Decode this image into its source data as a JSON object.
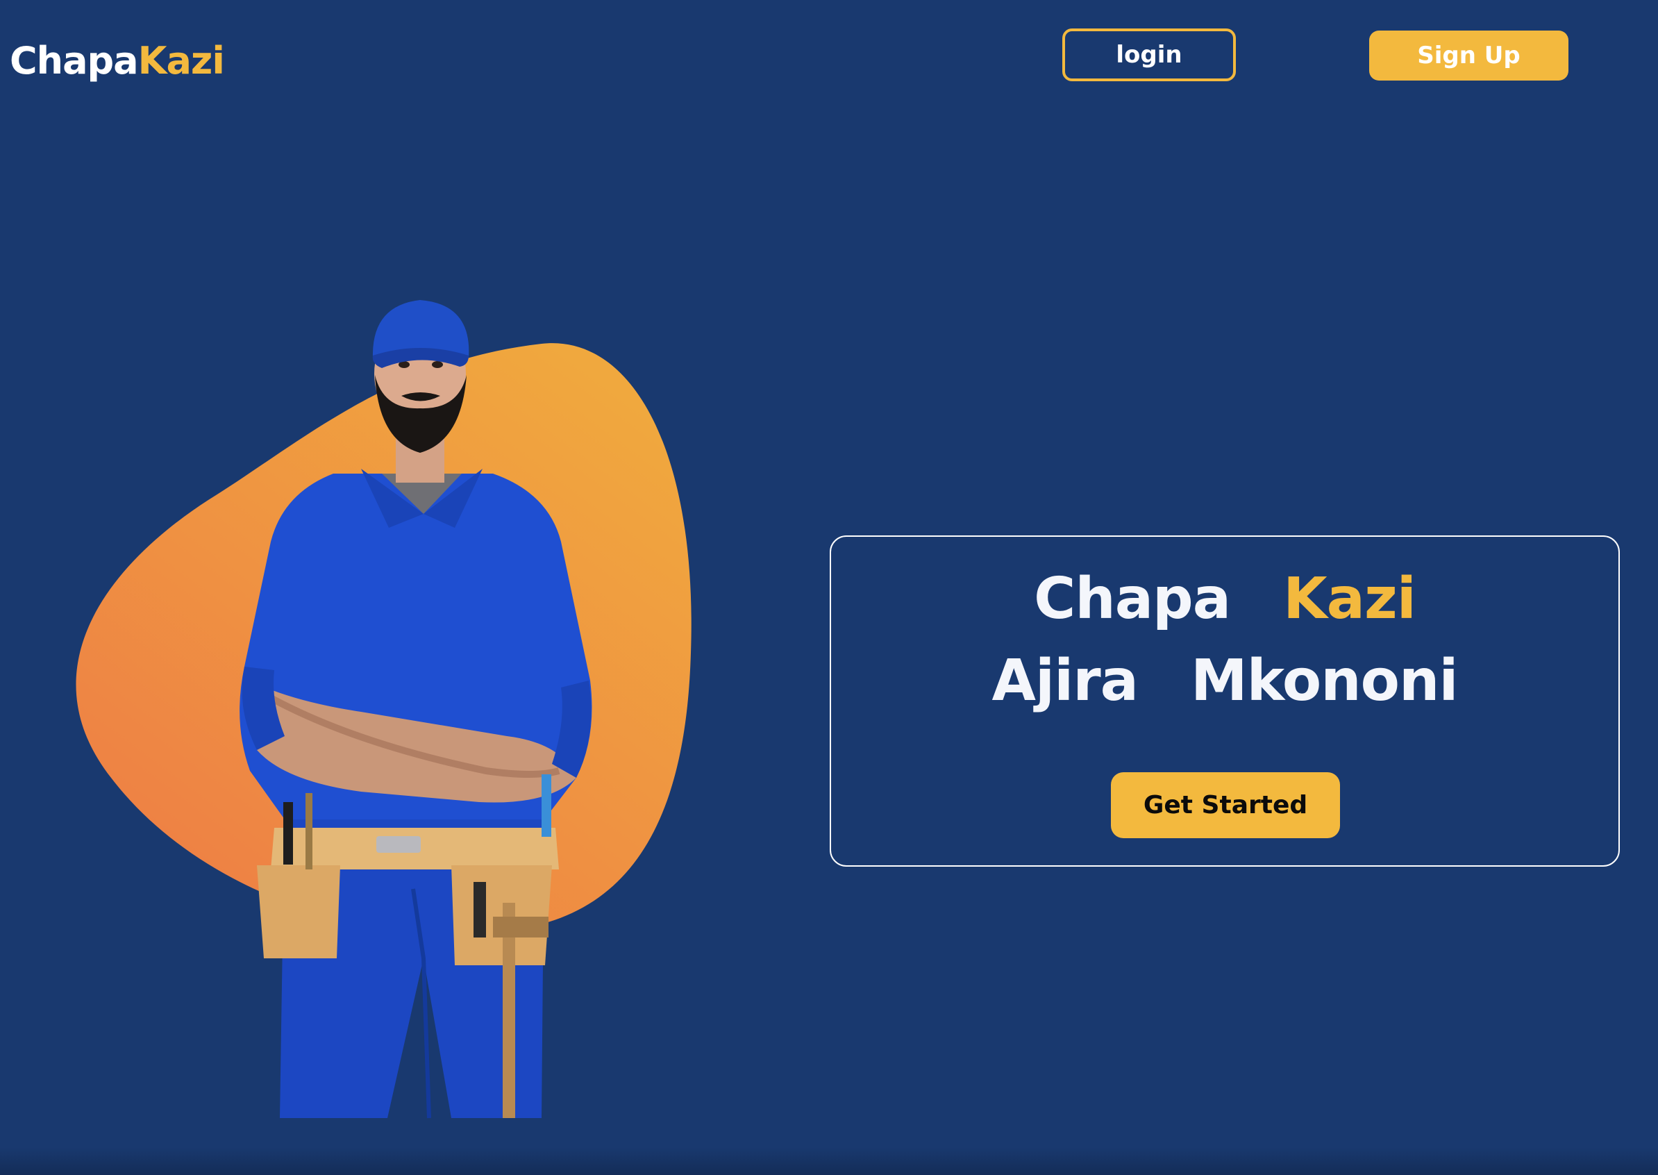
{
  "header": {
    "logo": {
      "part1": "Chapa",
      "part2": "Kazi"
    },
    "login_label": "login",
    "signup_label": "Sign Up"
  },
  "hero": {
    "title_line1": [
      "Chapa",
      "Kazi"
    ],
    "title_line2": [
      "Ajira",
      "Mkononi"
    ],
    "cta_label": "Get Started"
  },
  "colors": {
    "background": "#19396f",
    "accent": "#f3b93e",
    "blob_gradient": [
      "#f0a83e",
      "#ee7f45"
    ],
    "text_light": "#f4f6fb",
    "cta_text": "#0b0b0b"
  },
  "illustration": {
    "subject": "worker-in-blue-overalls-with-tool-belt",
    "backdrop": "orange-blob"
  }
}
